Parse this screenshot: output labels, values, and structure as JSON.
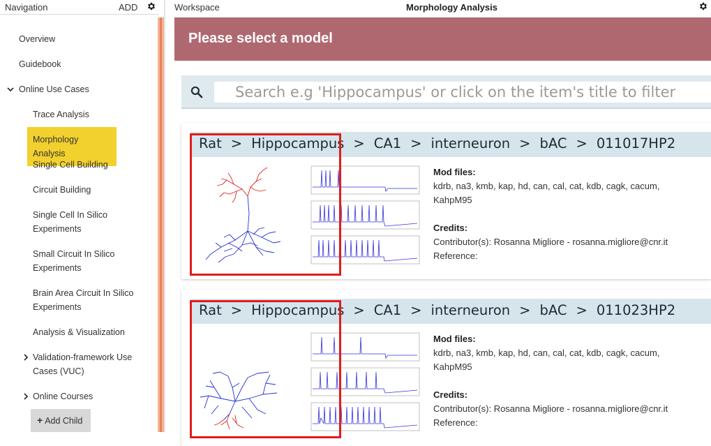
{
  "nav": {
    "title": "Navigation",
    "add_label": "ADD",
    "items": [
      {
        "label": "Overview"
      },
      {
        "label": "Guidebook"
      },
      {
        "label": "Online Use Cases"
      },
      {
        "label": "Trace Analysis"
      },
      {
        "label": "Morphology Analysis"
      },
      {
        "label": "Single Cell Building"
      },
      {
        "label": "Circuit Building"
      },
      {
        "label": "Single Cell In Silico Experiments"
      },
      {
        "label": "Small Circuit In Silico Experiments"
      },
      {
        "label": "Brain Area Circuit In Silico Experiments"
      },
      {
        "label": "Analysis & Visualization"
      },
      {
        "label": "Validation-framework Use Cases (VUC)"
      },
      {
        "label": "Online Courses"
      }
    ],
    "add_child_label": "Add Child"
  },
  "workspace": {
    "title": "Workspace",
    "center_title": "Morphology Analysis",
    "banner": "Please select a model",
    "search_placeholder": "Search e.g 'Hippocampus' or click on the item's title to filter"
  },
  "colors": {
    "banner": "#b06870",
    "active_nav": "#f2d12e",
    "crumb_bar": "#d5e5eb",
    "highlight_box": "#e01c1c",
    "splitter": "#e8835a"
  },
  "models": [
    {
      "crumbs": [
        "Rat",
        "Hippocampus",
        "CA1",
        "interneuron",
        "bAC",
        "011017HP2"
      ],
      "mod_files_label": "Mod files:",
      "mod_files": "kdrb,  na3,  kmb,  kap,  hd,  can,  cal,  cat,  kdb,  cagk,  cacum,",
      "mod_files_2": "KahpM95",
      "credits_label": "Credits:",
      "contributor": "Contributor(s): Rosanna Migliore - rosanna.migliore@cnr.it",
      "reference": "Reference:"
    },
    {
      "crumbs": [
        "Rat",
        "Hippocampus",
        "CA1",
        "interneuron",
        "bAC",
        "011023HP2"
      ],
      "mod_files_label": "Mod files:",
      "mod_files": "kdrb,  na3,  kmb,  kap,  hd,  can,  cal,  cat,  kdb,  cagk,  cacum,",
      "mod_files_2": "KahpM95",
      "credits_label": "Credits:",
      "contributor": "Contributor(s): Rosanna Migliore - rosanna.migliore@cnr.it",
      "reference": "Reference:"
    }
  ]
}
